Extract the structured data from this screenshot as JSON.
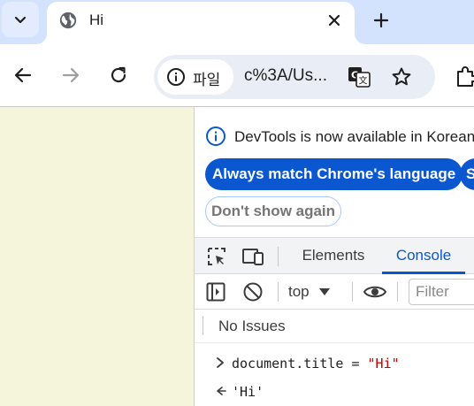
{
  "tab": {
    "title": "Hi",
    "favicon": "globe-icon",
    "close_icon": "close-icon"
  },
  "toolbar": {
    "site_chip_label": "파일",
    "url": "c%3A/Us...",
    "icons": [
      "back-icon",
      "forward-icon",
      "reload-icon",
      "info-icon",
      "translate-icon",
      "star-icon",
      "extensions-icon"
    ]
  },
  "page": {
    "background": "#f5f5dc"
  },
  "devtools": {
    "infobar": {
      "message": "DevTools is now available in Korean",
      "primary_button": "Always match Chrome's language",
      "secondary_button": "S",
      "dismiss_button": "Don't show again"
    },
    "tabs": [
      {
        "label": "Elements",
        "active": false
      },
      {
        "label": "Console",
        "active": true
      }
    ],
    "console_toolbar": {
      "context": "top",
      "filter_placeholder": "Filter"
    },
    "issues": "No Issues",
    "console": {
      "input_code": "document.title = ",
      "input_string": "\"Hi\"",
      "output_string": "'Hi'"
    },
    "accent_color": "#0b57d0"
  }
}
